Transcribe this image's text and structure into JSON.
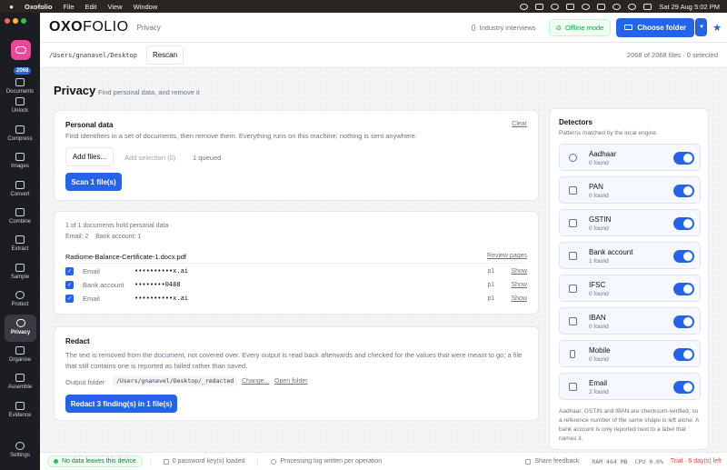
{
  "menubar": {
    "app": "Oxofolio",
    "menus": [
      "File",
      "Edit",
      "View",
      "Window"
    ],
    "datetime": "Sat 29 Aug  5:02 PM"
  },
  "sidebar": {
    "file_count": "2068",
    "items": [
      {
        "label": "Documents",
        "icon": "documents-icon"
      },
      {
        "label": "Unlock",
        "icon": "unlock-icon"
      },
      {
        "label": "Compress",
        "icon": "compress-icon"
      },
      {
        "label": "Images",
        "icon": "image-icon"
      },
      {
        "label": "Convert",
        "icon": "convert-icon"
      },
      {
        "label": "Combine",
        "icon": "combine-icon"
      },
      {
        "label": "Extract",
        "icon": "extract-icon"
      },
      {
        "label": "Sample",
        "icon": "sample-icon"
      },
      {
        "label": "Protect",
        "icon": "globe-icon"
      },
      {
        "label": "Privacy",
        "icon": "shield-icon",
        "active": true
      },
      {
        "label": "Organise",
        "icon": "grid-icon"
      },
      {
        "label": "Assemble",
        "icon": "assemble-icon"
      },
      {
        "label": "Evidence",
        "icon": "evidence-icon"
      }
    ],
    "settings_label": "Settings"
  },
  "header": {
    "brand_oxo": "OXO",
    "brand_folio": "FOLIO",
    "crumb": "Privacy",
    "interviews": "Industry interviews",
    "offline": "Offline mode",
    "choose": "Choose folder"
  },
  "pathbar": {
    "path": "/Users/gnanavel/Desktop",
    "rescan": "Rescan",
    "selection": "2068 of 2068 files · 0 selected"
  },
  "page": {
    "title": "Privacy",
    "subtitle": "Find personal data, and remove it"
  },
  "personal": {
    "title": "Personal data",
    "clear": "Clear",
    "desc": "Find identifiers in a set of documents, then remove them. Everything runs on this machine; nothing is sent anywhere.",
    "add_files": "Add files...",
    "add_selection": "Add selection (0)",
    "queued": "1 queued",
    "scan": "Scan 1 file(s)"
  },
  "results": {
    "summary": "1 of 1 documents hold personal data",
    "counts": "Email: 2    Bank account: 1",
    "file": "Radiome-Balance-Certificate-1.docx.pdf",
    "review": "Review pages",
    "findings": [
      {
        "type": "Email",
        "value": "••••••••••x.ai",
        "page": "p1",
        "show": "Show"
      },
      {
        "type": "Bank account",
        "value": "••••••••0488",
        "page": "p1",
        "show": "Show"
      },
      {
        "type": "Email",
        "value": "••••••••••x.ai",
        "page": "p1",
        "show": "Show"
      }
    ]
  },
  "redact": {
    "title": "Redact",
    "desc": "The text is removed from the document, not covered over. Every output is read back afterwards and checked for the values that were meant to go; a file that still contains one is reported as failed rather than saved.",
    "output_label": "Output folder",
    "output_path": "/Users/gnanavel/Desktop/_redacted",
    "change": "Change...",
    "open": "Open folder",
    "button": "Redact 3 finding(s) in 1 file(s)"
  },
  "detectors": {
    "title": "Detectors",
    "subtitle": "Patterns matched by the local engine.",
    "items": [
      {
        "name": "Aadhaar",
        "count": "0 found",
        "icon": "person-icon",
        "enabled": true
      },
      {
        "name": "PAN",
        "count": "0 found",
        "icon": "card-icon",
        "enabled": true
      },
      {
        "name": "GSTIN",
        "count": "0 found",
        "icon": "receipt-icon",
        "enabled": true
      },
      {
        "name": "Bank account",
        "count": "1 found",
        "icon": "bank-icon",
        "enabled": true
      },
      {
        "name": "IFSC",
        "count": "0 found",
        "icon": "code-icon",
        "enabled": true
      },
      {
        "name": "IBAN",
        "count": "0 found",
        "icon": "iban-card-icon",
        "enabled": true
      },
      {
        "name": "Mobile",
        "count": "0 found",
        "icon": "phone-icon",
        "enabled": true
      },
      {
        "name": "Email",
        "count": "2 found",
        "icon": "mail-icon",
        "enabled": true
      }
    ],
    "note": "Aadhaar, GSTIN and IBAN are checksum-verified, so a reference number of the same shape is left alone. A bank account is only reported next to a label that names it."
  },
  "footer": {
    "no_data": "No data leaves this device",
    "password": "0 password key(s) loaded",
    "log": "Processing log written per operation",
    "feedback": "Share feedback",
    "ram": "RAM 464 MB",
    "cpu": "CPU 0.0%",
    "trial": "Trial · 6 day(s) left"
  },
  "colors": {
    "accent": "#2563eb",
    "sidebar_bg": "#1c1d22",
    "success": "#16a34a",
    "trial": "#ef4444"
  }
}
